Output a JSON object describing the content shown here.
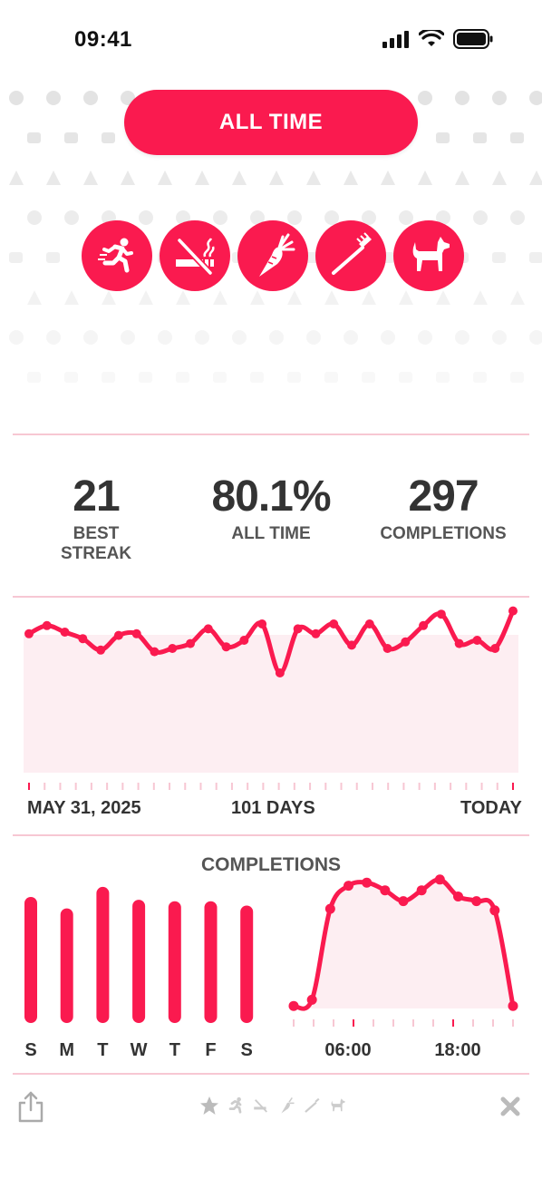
{
  "status_bar": {
    "time": "09:41"
  },
  "range_button": {
    "label": "ALL TIME"
  },
  "habits": [
    {
      "icon": "running-person-icon"
    },
    {
      "icon": "no-smoking-icon"
    },
    {
      "icon": "carrot-icon"
    },
    {
      "icon": "toothbrush-icon"
    },
    {
      "icon": "dog-icon"
    }
  ],
  "stats": {
    "best_streak": {
      "value": "21",
      "label": "BEST STREAK"
    },
    "rate": {
      "value": "80.1%",
      "label": "ALL TIME"
    },
    "completions": {
      "value": "297",
      "label": "COMPLETIONS"
    }
  },
  "timeline": {
    "start_label": "MAY 31, 2025",
    "span_label": "101 DAYS",
    "end_label": "TODAY",
    "values": [
      0.84,
      0.89,
      0.85,
      0.81,
      0.74,
      0.83,
      0.84,
      0.73,
      0.75,
      0.78,
      0.87,
      0.76,
      0.8,
      0.9,
      0.6,
      0.87,
      0.84,
      0.9,
      0.77,
      0.9,
      0.75,
      0.79,
      0.89,
      0.96,
      0.78,
      0.8,
      0.75,
      0.98
    ]
  },
  "completions": {
    "title": "COMPLETIONS",
    "weekday_labels": [
      "S",
      "M",
      "T",
      "W",
      "T",
      "F",
      "S"
    ],
    "weekday_values": [
      0.88,
      0.8,
      0.95,
      0.86,
      0.85,
      0.85,
      0.82
    ],
    "hour_labels": [
      "06:00",
      "18:00"
    ],
    "hour_values": [
      0.04,
      0.08,
      0.67,
      0.82,
      0.84,
      0.79,
      0.72,
      0.79,
      0.86,
      0.75,
      0.72,
      0.66,
      0.04
    ]
  },
  "colors": {
    "accent": "#fa1a4f",
    "fill": "#fdeef2",
    "divider": "#f7c7d3"
  }
}
